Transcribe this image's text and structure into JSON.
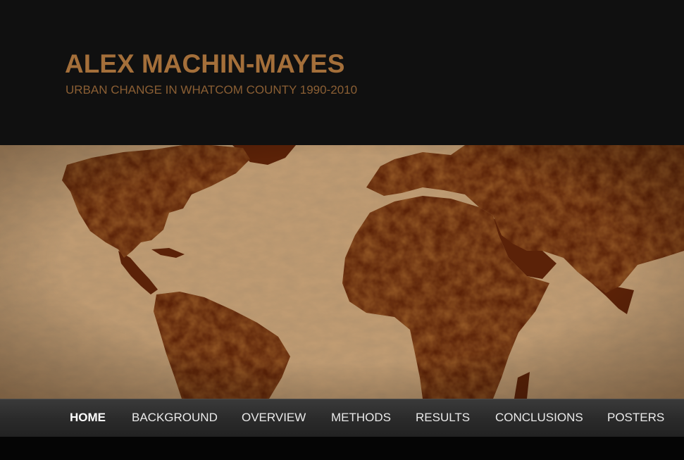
{
  "header": {
    "title": "ALEX MACHIN-MAYES",
    "tagline": "URBAN CHANGE IN WHATCOM COUNTY 1990-2010"
  },
  "banner": {
    "image": "world-map-parchment"
  },
  "nav": {
    "items": [
      {
        "label": "HOME",
        "active": true
      },
      {
        "label": "BACKGROUND",
        "active": false
      },
      {
        "label": "OVERVIEW",
        "active": false
      },
      {
        "label": "METHODS",
        "active": false
      },
      {
        "label": "RESULTS",
        "active": false
      },
      {
        "label": "CONCLUSIONS",
        "active": false
      },
      {
        "label": "POSTERS",
        "active": false
      }
    ]
  },
  "colors": {
    "title": "#a46f3a",
    "tagline": "#8b5f34",
    "header_bg": "#101010",
    "nav_bg": "#2b2b2b",
    "nav_text": "#eaeaea"
  }
}
